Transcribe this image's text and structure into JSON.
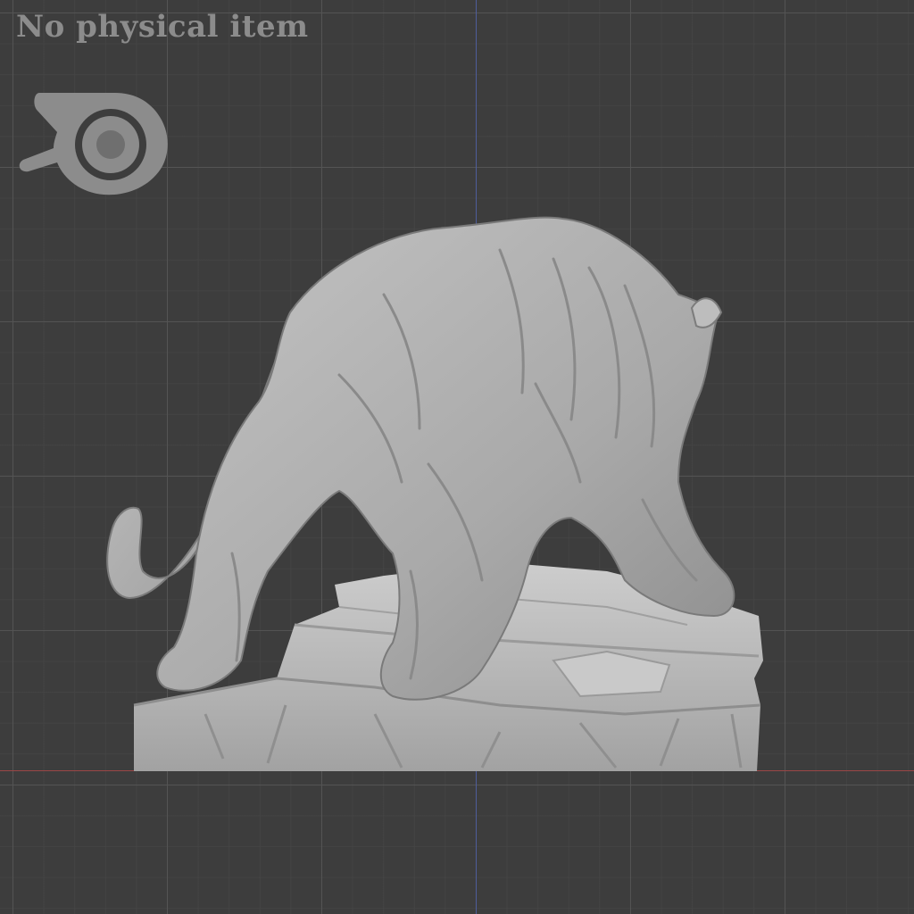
{
  "watermark": {
    "text": "No physical item",
    "logo_icon": "blender-logo-icon"
  },
  "viewport": {
    "background_color": "#3d3d3d",
    "grid_color": "#555555",
    "y_axis_color": "#4e5d9b",
    "x_axis_color": "#9a4646",
    "model_color": "#b4b4b4"
  },
  "scene": {
    "object_icon": "panther-statue-icon"
  }
}
